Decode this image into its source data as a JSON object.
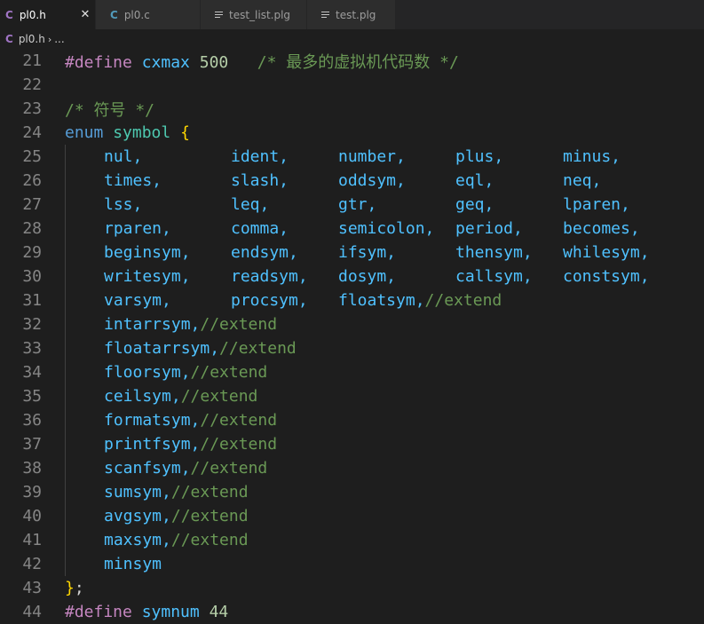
{
  "tabs": [
    {
      "icon": "C",
      "label": "pl0.h",
      "active": true,
      "close": "✕"
    },
    {
      "icon": "C",
      "label": "pl0.c",
      "active": false
    },
    {
      "icon": "lines",
      "label": "test_list.plg",
      "active": false
    },
    {
      "icon": "lines",
      "label": "test.plg",
      "active": false
    }
  ],
  "breadcrumb": {
    "icon": "C",
    "file": "pl0.h",
    "sep": "›",
    "rest": "..."
  },
  "colors": {
    "background": "#1e1e1e",
    "preprocessor": "#c586c0",
    "macro": "#4fc1ff",
    "number": "#b5cea8",
    "comment": "#6a9955",
    "keyword": "#569cd6",
    "type": "#4ec9b0",
    "brace": "#ffd700"
  },
  "code": {
    "line21": {
      "num": "21",
      "kw": "#define",
      "name": "cxmax",
      "val": "500",
      "cmt": "/* 最多的虚拟机代码数 */"
    },
    "line22": {
      "num": "22"
    },
    "line23": {
      "num": "23",
      "cmt": "/* 符号 */"
    },
    "line24": {
      "num": "24",
      "kw": "enum",
      "name": "symbol",
      "brace": "{"
    },
    "rows": [
      {
        "num": "25",
        "cols": [
          "nul,",
          "ident,",
          "number,",
          "plus,",
          "minus,"
        ]
      },
      {
        "num": "26",
        "cols": [
          "times,",
          "slash,",
          "oddsym,",
          "eql,",
          "neq,"
        ]
      },
      {
        "num": "27",
        "cols": [
          "lss,",
          "leq,",
          "gtr,",
          "geq,",
          "lparen,"
        ]
      },
      {
        "num": "28",
        "cols": [
          "rparen,",
          "comma,",
          "semicolon,",
          "period,",
          "becomes,"
        ]
      },
      {
        "num": "29",
        "cols": [
          "beginsym,",
          "endsym,",
          "ifsym,",
          "thensym,",
          "whilesym,"
        ]
      },
      {
        "num": "30",
        "cols": [
          "writesym,",
          "readsym,",
          "dosym,",
          "callsym,",
          "constsym,"
        ]
      },
      {
        "num": "31",
        "cols": [
          "varsym,",
          "procsym,",
          "floatsym,"
        ],
        "cmt": "//extend"
      }
    ],
    "ext": [
      {
        "num": "32",
        "name": "intarrsym,",
        "cmt": "//extend"
      },
      {
        "num": "33",
        "name": "floatarrsym,",
        "cmt": "//extend"
      },
      {
        "num": "34",
        "name": "floorsym,",
        "cmt": "//extend"
      },
      {
        "num": "35",
        "name": "ceilsym,",
        "cmt": "//extend"
      },
      {
        "num": "36",
        "name": "formatsym,",
        "cmt": "//extend"
      },
      {
        "num": "37",
        "name": "printfsym,",
        "cmt": "//extend"
      },
      {
        "num": "38",
        "name": "scanfsym,",
        "cmt": "//extend"
      },
      {
        "num": "39",
        "name": "sumsym,",
        "cmt": "//extend"
      },
      {
        "num": "40",
        "name": "avgsym,",
        "cmt": "//extend"
      },
      {
        "num": "41",
        "name": "maxsym,",
        "cmt": "//extend"
      },
      {
        "num": "42",
        "name": "minsym",
        "cmt": ""
      }
    ],
    "line43": {
      "num": "43",
      "brace": "}",
      "semi": ";"
    },
    "line44": {
      "num": "44",
      "kw": "#define",
      "name": "symnum",
      "val": "44"
    }
  }
}
